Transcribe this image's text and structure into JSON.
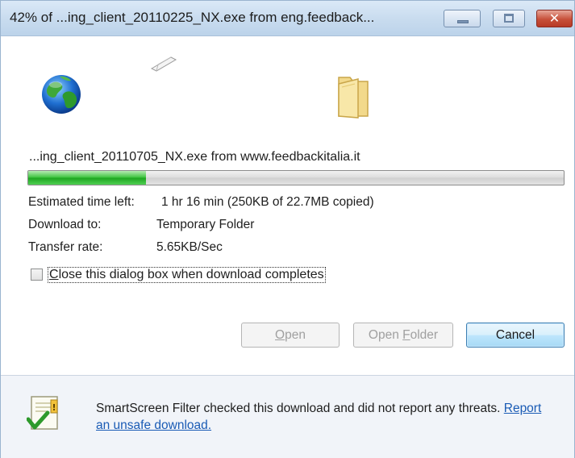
{
  "window": {
    "title": "42% of ...ing_client_20110225_NX.exe from eng.feedback...",
    "minimize_icon": "minimize-icon",
    "maximize_icon": "maximize-icon",
    "close_glyph": "✕"
  },
  "download": {
    "file_from": "...ing_client_20110705_NX.exe from  www.feedbackitalia.it",
    "progress_percent": 22,
    "progress_color": "#37c23a"
  },
  "info": {
    "estimated_label": "Estimated time left:",
    "estimated_value": "1 hr 16 min (250KB of 22.7MB copied)",
    "download_to_label": "Download to:",
    "download_to_value": "Temporary Folder",
    "transfer_rate_label": "Transfer rate:",
    "transfer_rate_value": "5.65KB/Sec"
  },
  "options": {
    "close_when_done_prefix": "C",
    "close_when_done_rest": "lose this dialog box when download completes",
    "close_when_done_checked": false
  },
  "buttons": {
    "open_prefix": "O",
    "open_rest": "pen",
    "open_folder_a": "Open ",
    "open_folder_b": "F",
    "open_folder_c": "older",
    "cancel": "Cancel"
  },
  "smartscreen": {
    "message": "SmartScreen Filter checked this download and did not report any threats. ",
    "link": "Report an unsafe download."
  },
  "icons": {
    "globe": "globe-icon",
    "paper": "flying-document-icon",
    "folder": "folder-icon",
    "shield": "smartscreen-check-icon"
  }
}
